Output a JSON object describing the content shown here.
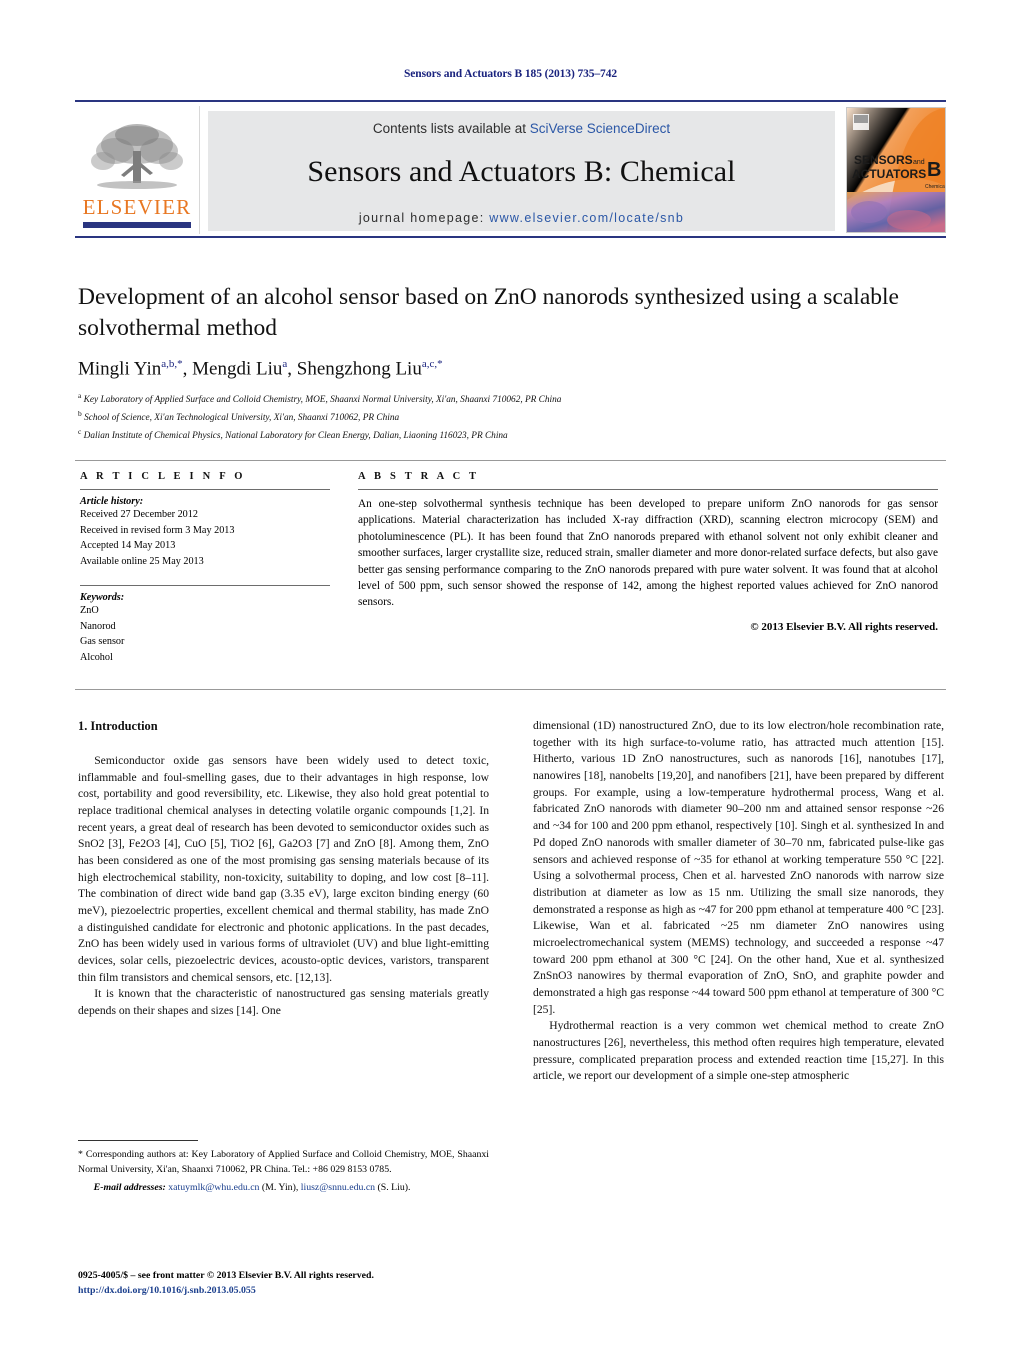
{
  "running_head": "Sensors and Actuators B 185 (2013) 735–742",
  "masthead": {
    "contents_prefix": "Contents lists available at ",
    "contents_link": "SciVerse ScienceDirect",
    "journal_title": "Sensors and Actuators B: Chemical",
    "homepage_label": "journal homepage:",
    "homepage_url": "www.elsevier.com/locate/snb",
    "publisher_wordmark": "ELSEVIER",
    "cover": {
      "line1": "SENSORS",
      "line1b": "and",
      "line2": "ACTUATORS",
      "letter": "B",
      "sublabel": "Chemical"
    },
    "accent_orange": "#E87722",
    "accent_blue": "#2a3580",
    "band_gray": "#e6e7e8"
  },
  "article": {
    "title": "Development of an alcohol sensor based on ZnO nanorods synthesized using a scalable solvothermal method",
    "authors": [
      {
        "name": "Mingli Yin",
        "sup": "a,b,*"
      },
      {
        "name": "Mengdi Liu",
        "sup": "a"
      },
      {
        "name": "Shengzhong Liu",
        "sup": "a,c,*"
      }
    ],
    "affiliations": [
      {
        "mark": "a",
        "text": "Key Laboratory of Applied Surface and Colloid Chemistry, MOE, Shaanxi Normal University, Xi'an, Shaanxi 710062, PR China"
      },
      {
        "mark": "b",
        "text": "School of Science, Xi'an Technological University, Xi'an, Shaanxi 710062, PR China"
      },
      {
        "mark": "c",
        "text": "Dalian Institute of Chemical Physics, National Laboratory for Clean Energy, Dalian, Liaoning 116023, PR China"
      }
    ]
  },
  "article_info": {
    "heading": "A R T I C L E   I N F O",
    "history_label": "Article history:",
    "history": [
      "Received 27 December 2012",
      "Received in revised form 3 May 2013",
      "Accepted 14 May 2013",
      "Available online 25 May 2013"
    ],
    "keywords_label": "Keywords:",
    "keywords": [
      "ZnO",
      "Nanorod",
      "Gas sensor",
      "Alcohol"
    ]
  },
  "abstract": {
    "heading": "A B S T R A C T",
    "text": "An one-step solvothermal synthesis technique has been developed to prepare uniform ZnO nanorods for gas sensor applications. Material characterization has included X-ray diffraction (XRD), scanning electron microcopy (SEM) and photoluminescence (PL). It has been found that ZnO nanorods prepared with ethanol solvent not only exhibit cleaner and smoother surfaces, larger crystallite size, reduced strain, smaller diameter and more donor-related surface defects, but also gave better gas sensing performance comparing to the ZnO nanorods prepared with pure water solvent. It was found that at alcohol level of 500 ppm, such sensor showed the response of 142, among the highest reported values achieved for ZnO nanorod sensors.",
    "copyright": "© 2013 Elsevier B.V. All rights reserved."
  },
  "introduction": {
    "heading": "1.  Introduction",
    "left_paragraphs": [
      "Semiconductor oxide gas sensors have been widely used to detect toxic, inflammable and foul-smelling gases, due to their advantages in high response, low cost, portability and good reversibility, etc. Likewise, they also hold great potential to replace traditional chemical analyses in detecting volatile organic compounds [1,2]. In recent years, a great deal of research has been devoted to semiconductor oxides such as SnO2 [3], Fe2O3 [4], CuO [5], TiO2 [6], Ga2O3 [7] and ZnO [8]. Among them, ZnO has been considered as one of the most promising gas sensing materials because of its high electrochemical stability, non-toxicity, suitability to doping, and low cost [8–11]. The combination of direct wide band gap (3.35 eV), large exciton binding energy (60 meV), piezoelectric properties, excellent chemical and thermal stability, has made ZnO a distinguished candidate for electronic and photonic applications. In the past decades, ZnO has been widely used in various forms of ultraviolet (UV) and blue light-emitting devices, solar cells, piezoelectric devices, acousto-optic devices, varistors, transparent thin film transistors and chemical sensors, etc. [12,13].",
      "It is known that the characteristic of nanostructured gas sensing materials greatly depends on their shapes and sizes [14]. One"
    ],
    "right_paragraphs": [
      "dimensional (1D) nanostructured ZnO, due to its low electron/hole recombination rate, together with its high surface-to-volume ratio, has attracted much attention [15]. Hitherto, various 1D ZnO nanostructures, such as nanorods [16], nanotubes [17], nanowires [18], nanobelts [19,20], and nanofibers [21], have been prepared by different groups. For example, using a low-temperature hydrothermal process, Wang et al. fabricated ZnO nanorods with diameter 90–200 nm and attained sensor response ~26 and ~34 for 100 and 200 ppm ethanol, respectively [10]. Singh et al. synthesized In and Pd doped ZnO nanorods with smaller diameter of 30–70 nm, fabricated pulse-like gas sensors and achieved response of ~35 for ethanol at working temperature 550 °C [22]. Using a solvothermal process, Chen et al. harvested ZnO nanorods with narrow size distribution at diameter as low as 15 nm. Utilizing the small size nanorods, they demonstrated a response as high as ~47 for 200 ppm ethanol at temperature 400 °C [23]. Likewise, Wan et al. fabricated ~25 nm diameter ZnO nanowires using microelectromechanical system (MEMS) technology, and succeeded a response ~47 toward 200 ppm ethanol at 300 °C [24]. On the other hand, Xue et al. synthesized ZnSnO3 nanowires by thermal evaporation of ZnO, SnO, and graphite powder and demonstrated a high gas response ~44 toward 500 ppm ethanol at temperature of 300 °C [25].",
      "Hydrothermal reaction is a very common wet chemical method to create ZnO nanostructures [26], nevertheless, this method often requires high temperature, elevated pressure, complicated preparation process and extended reaction time [15,27]. In this article, we report our development of a simple one-step atmospheric"
    ]
  },
  "footnotes": {
    "corresponding": "* Corresponding authors at: Key Laboratory of Applied Surface and Colloid Chemistry, MOE, Shaanxi Normal University, Xi'an, Shaanxi 710062, PR China. Tel.: +86 029 8153 0785.",
    "email_label": "E-mail addresses:",
    "email1": "xatuymlk@whu.edu.cn",
    "email1_owner": "(M. Yin)",
    "email2": "liusz@snnu.edu.cn",
    "email2_owner": "(S. Liu)."
  },
  "imprint": {
    "line1": "0925-4005/$ – see front matter © 2013 Elsevier B.V. All rights reserved.",
    "doi": "http://dx.doi.org/10.1016/j.snb.2013.05.055"
  }
}
